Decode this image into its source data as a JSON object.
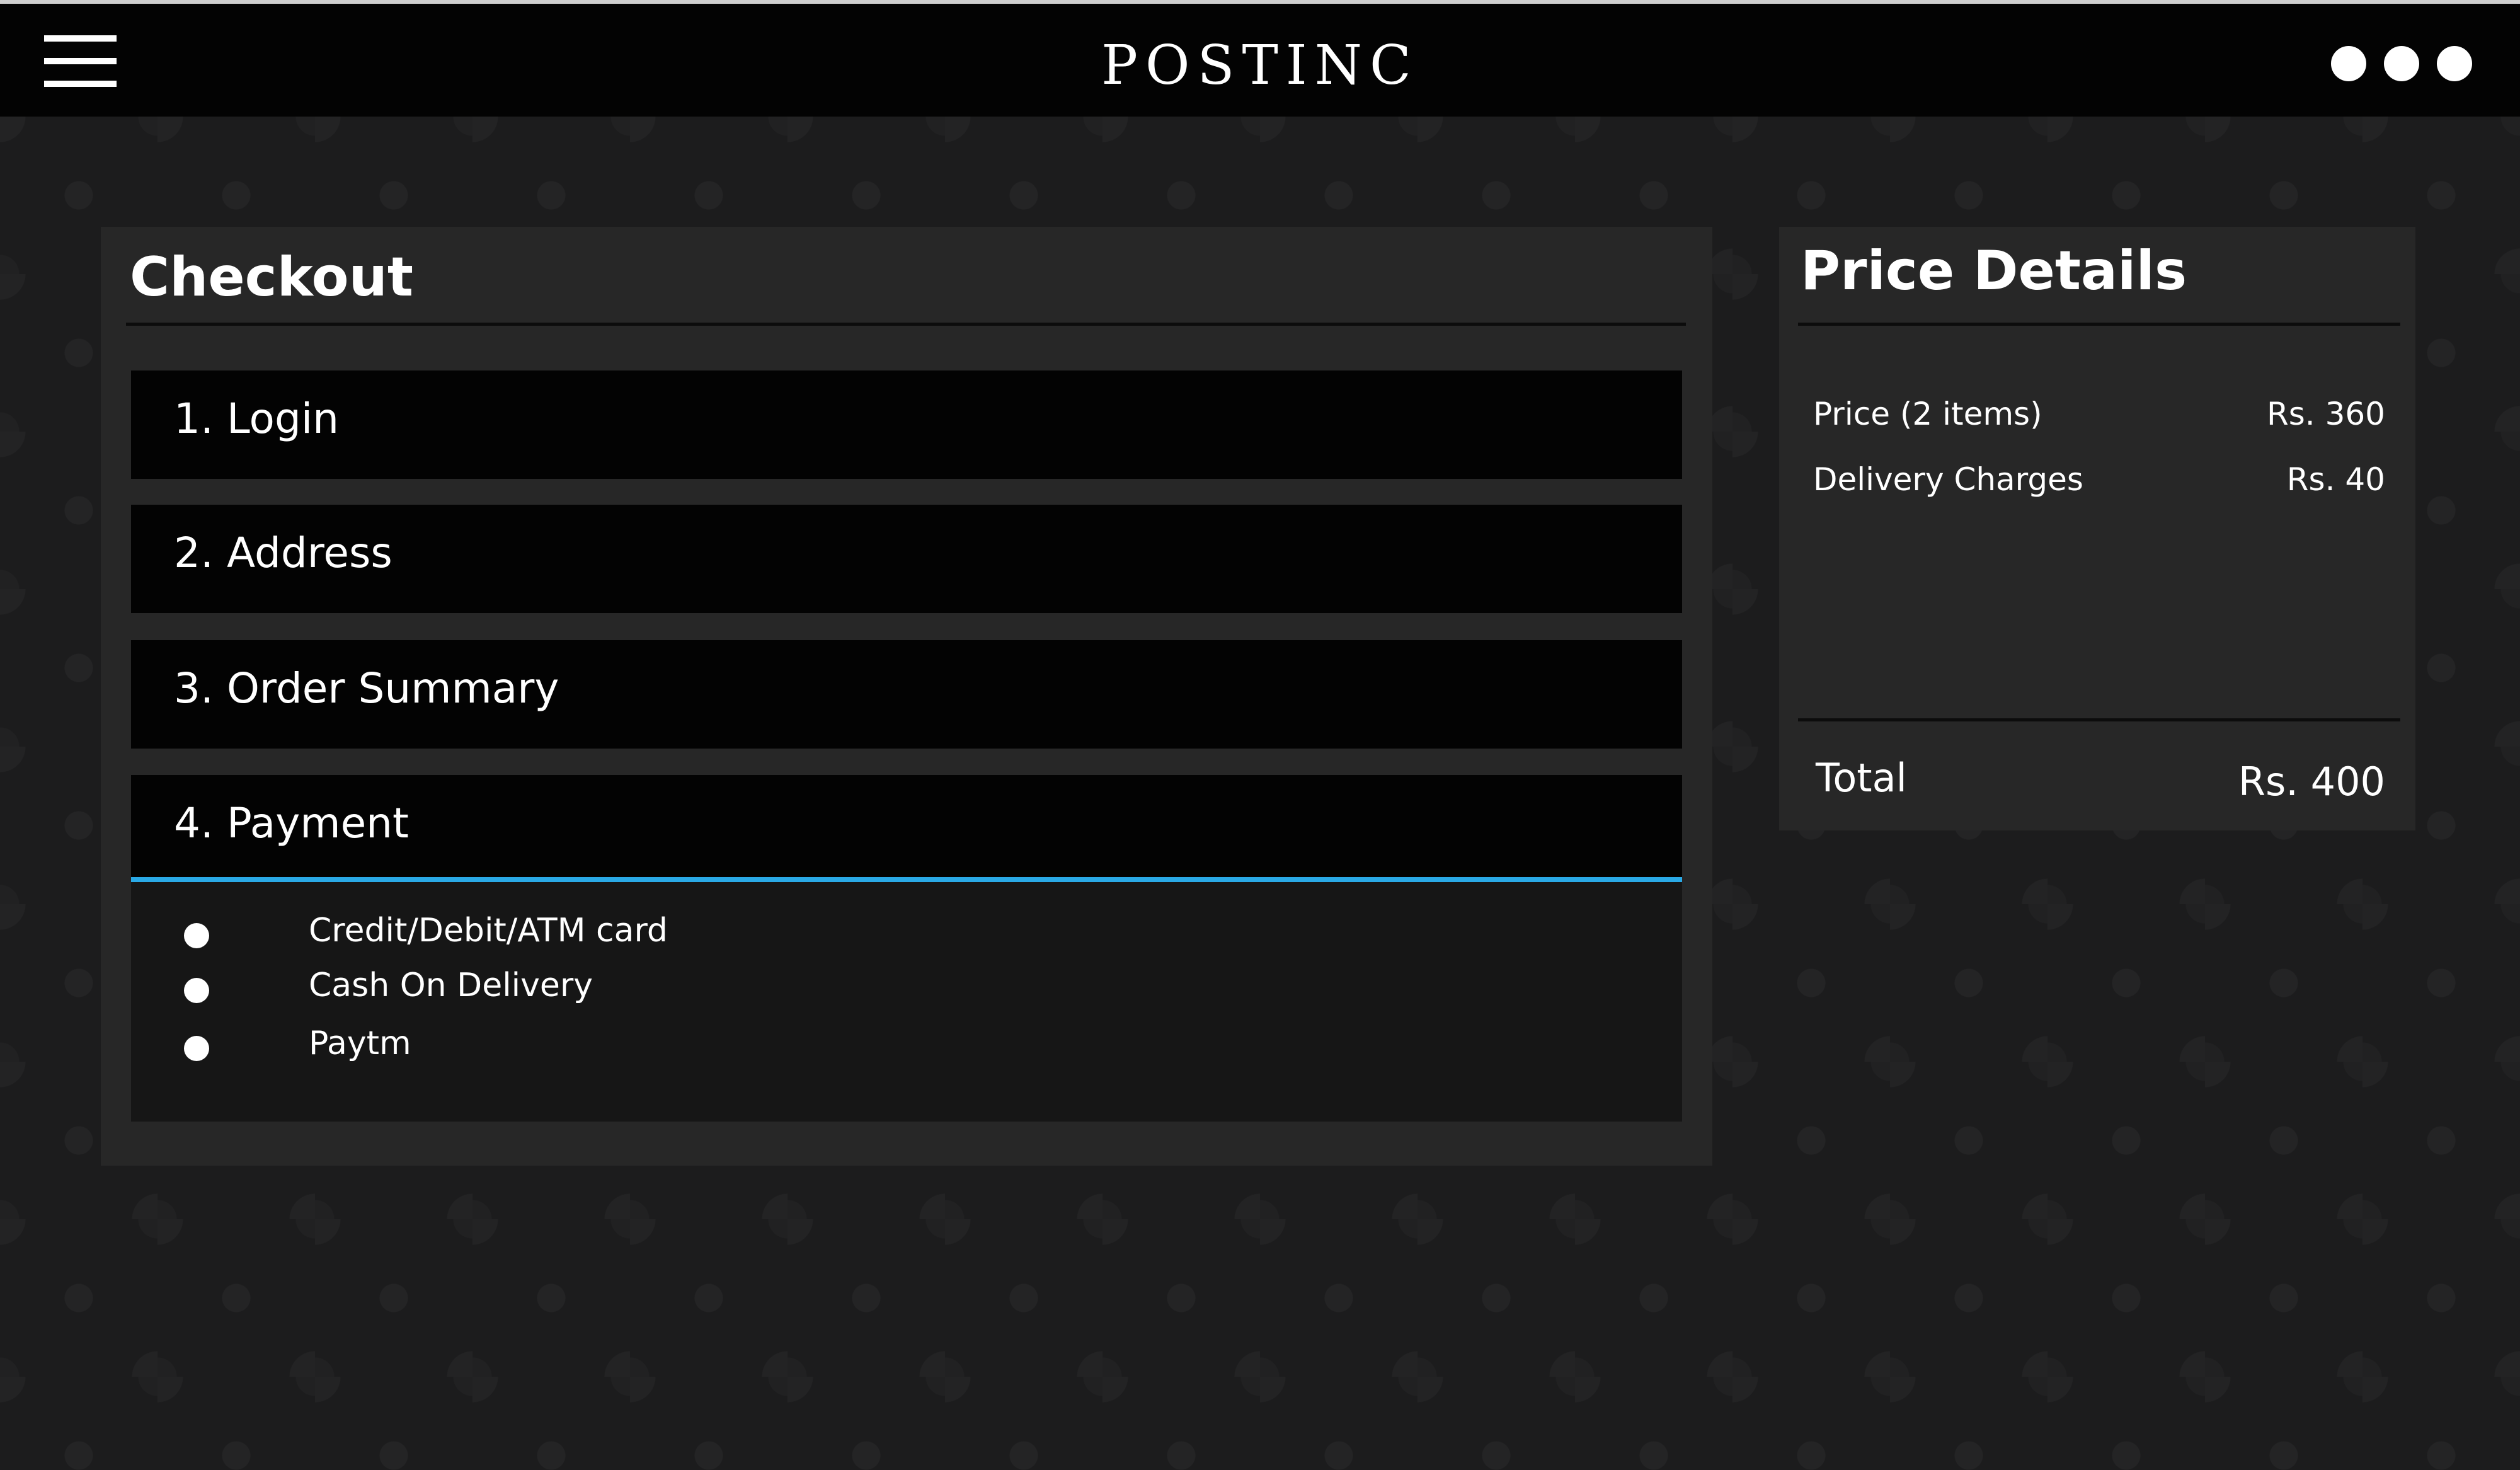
{
  "header": {
    "brand": "POSTINC",
    "menu_icon": "hamburger-menu-icon",
    "more_icon": "more-options-icon"
  },
  "checkout": {
    "title": "Checkout",
    "steps": [
      {
        "label": "1. Login"
      },
      {
        "label": "2. Address"
      },
      {
        "label": "3. Order Summary"
      },
      {
        "label": "4. Payment"
      }
    ],
    "active_step_accent": "#2aa9e6",
    "payment_options": [
      {
        "label": "Credit/Debit/ATM card"
      },
      {
        "label": "Cash On Delivery"
      },
      {
        "label": "Paytm"
      }
    ]
  },
  "price_details": {
    "title": "Price Details",
    "rows": [
      {
        "label": "Price (2 items)",
        "value": "Rs. 360"
      },
      {
        "label": "Delivery Charges",
        "value": "Rs. 40"
      }
    ],
    "total": {
      "label": "Total",
      "value": "Rs. 400"
    }
  }
}
